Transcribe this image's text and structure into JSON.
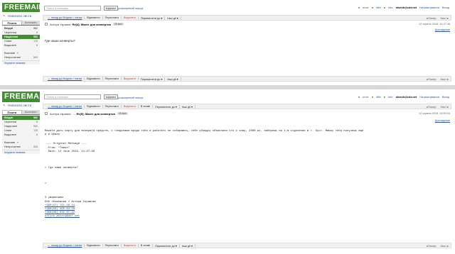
{
  "logo": "FREEMAIL",
  "search": {
    "placeholder": "Поиск в письмах",
    "button": "Шукати",
    "advanced": "розширений пошук"
  },
  "user": {
    "links": [
      "істот",
      "kfbt",
      "info",
      "ukr"
    ],
    "email": "stvesh@ukr.net",
    "settings": "Налаштування",
    "exit": "Вихід"
  },
  "sidebar": {
    "write": "Написати листа",
    "tabs": [
      "Пошта",
      "Контакти"
    ],
    "folders": [
      {
        "label": "Вхідні",
        "count": "562",
        "bold": true
      },
      {
        "label": "Чернетки",
        "count": "8"
      },
      {
        "label": "Надіслані",
        "count": "552",
        "active": true
      },
      {
        "label": "Спам",
        "count": "125"
      },
      {
        "label": "Видалені",
        "count": "8"
      }
    ],
    "extra": [
      {
        "label": "Важливі",
        "star": "★"
      },
      {
        "label": "Непрочитані",
        "count": "563"
      }
    ],
    "manage": "Керувати папками"
  },
  "toolbar": {
    "back": "← назад до Вхідних / папки",
    "items": [
      "Відповісти",
      "Переслати",
      "Видалити",
      "Перемістити до ▾",
      "Інші дії ▾"
    ],
    "items_full": [
      "Відповісти",
      "Переслати",
      "Видалити",
      "В спам!",
      "Перемістити до ▾",
      "Інші дії ▾"
    ],
    "prev": "◂ Попер",
    "next": "Наст ▸"
  },
  "message1": {
    "sender": "Астера Украина",
    "subject": "Re[4]: Макет для конвертов",
    "badge": "25 мин",
    "date": "12 червня 2018, 14:27:46",
    "more": "Докладніше",
    "body": "Где наши конверты?"
  },
  "message2": {
    "sender": "Астера Украина",
    "arrow": "→",
    "subject": "Re[5]: Макет для конвертов",
    "badge": "25 мин",
    "date": "12 червня 2018, 15:50:15",
    "more": "Докладніше",
    "body_main": "Макати дать карту для возврата средств, с гандонами вроде тебя я работать не собираюсь, тебе ублюдку объяснили что к чему, 2000 шт. заберешь на 1-м отделении в г. Хуст. Мамку тебя получешь еще\nи в ебало",
    "original_header": " --- Original Message ---\n  From: \"Тимон\"\n  Date: 12 June 2018, 14:27:46",
    "quoted": "> Где наши конверты?",
    "quoted_empty": ">",
    "signature": "З уважением\nООО «Компания » Астера Украина»",
    "phones": [
      "+380(97) 761-46-44",
      "+380(63) 395-84-18",
      "+380(99) 032-87-22"
    ],
    "email": "office_astera@ukr.net"
  }
}
